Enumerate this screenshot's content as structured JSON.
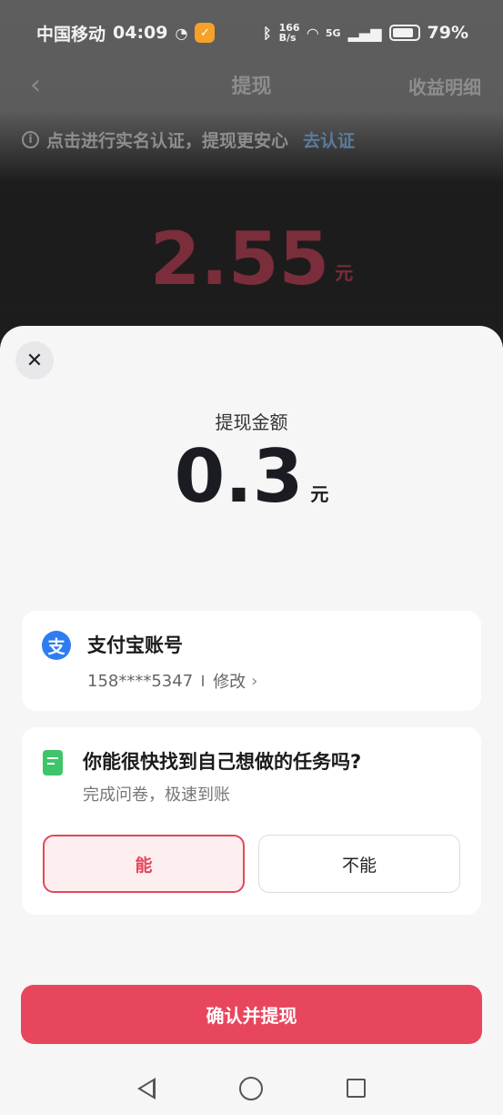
{
  "status_bar": {
    "carrier": "中国移动",
    "time": "04:09",
    "speed": "166\nB/s",
    "network": "5G",
    "battery": "79%"
  },
  "header": {
    "back_icon": "chevron-left-icon",
    "title": "提现",
    "right_link": "收益明细"
  },
  "notice": {
    "text": "点击进行实名认证，提现更安心",
    "link": "去认证"
  },
  "balance": {
    "value": "2.55",
    "unit": "元"
  },
  "sheet": {
    "close_icon": "close-icon",
    "amount_label": "提现金额",
    "amount_value": "0.3",
    "amount_unit": "元",
    "account": {
      "icon": "alipay-icon",
      "icon_glyph": "支",
      "title": "支付宝账号",
      "number": "158****5347",
      "edit_label": "修改"
    },
    "survey": {
      "icon": "document-icon",
      "question": "你能很快找到自己想做的任务吗?",
      "subtitle": "完成问卷，极速到账",
      "option_yes": "能",
      "option_no": "不能"
    },
    "confirm_label": "确认并提现"
  },
  "colors": {
    "accent": "#e8465d",
    "alipay": "#2e7cf2",
    "doc": "#3ec56a"
  }
}
